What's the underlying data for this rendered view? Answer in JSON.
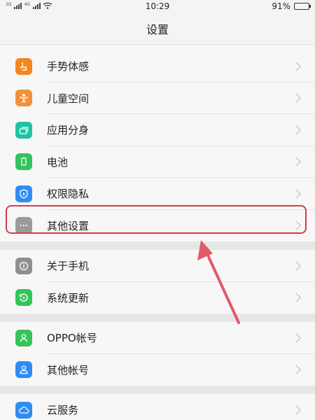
{
  "status_bar": {
    "time": "10:29",
    "battery_percent": "91%",
    "battery_level": 0.91,
    "signal_tag_1": "2G",
    "signal_tag_2": "4G"
  },
  "header": {
    "title": "设置"
  },
  "groups": [
    {
      "items": [
        {
          "label": "手势体感",
          "icon": "hand-gesture-icon",
          "color": "#f5861f"
        },
        {
          "label": "儿童空间",
          "icon": "child-icon",
          "color": "#f0913a"
        },
        {
          "label": "应用分身",
          "icon": "app-clone-icon",
          "color": "#1fc3a2"
        },
        {
          "label": "电池",
          "icon": "battery-icon",
          "color": "#34c45b"
        },
        {
          "label": "权限隐私",
          "icon": "shield-icon",
          "color": "#2f8cf2"
        },
        {
          "label": "其他设置",
          "icon": "more-dots-icon",
          "color": "#9a9a9a"
        }
      ]
    },
    {
      "items": [
        {
          "label": "关于手机",
          "icon": "info-icon",
          "color": "#8f8f8f"
        },
        {
          "label": "系统更新",
          "icon": "update-icon",
          "color": "#34c45b"
        }
      ]
    },
    {
      "items": [
        {
          "label": "OPPO帐号",
          "icon": "user-icon",
          "color": "#34c45b"
        },
        {
          "label": "其他帐号",
          "icon": "account-icon",
          "color": "#2f8cf2"
        }
      ]
    },
    {
      "items": [
        {
          "label": "云服务",
          "icon": "cloud-icon",
          "color": "#2f8cf2"
        }
      ]
    }
  ],
  "annotation": {
    "highlighted_item": "其他设置",
    "color": "#d93a4b"
  }
}
